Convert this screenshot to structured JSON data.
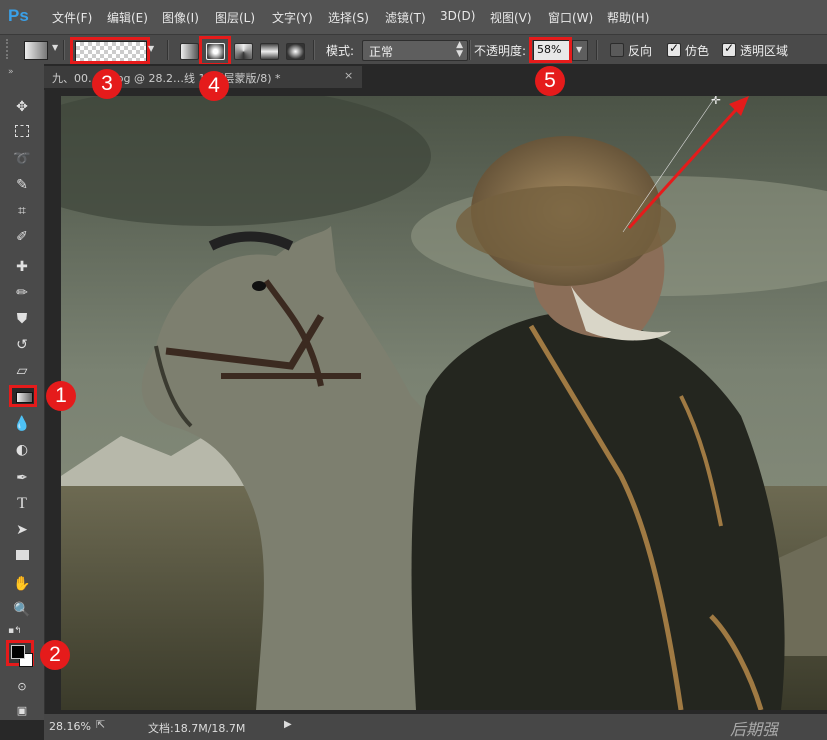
{
  "app": {
    "logo": "Ps"
  },
  "menu": [
    "文件(F)",
    "编辑(E)",
    "图像(I)",
    "图层(L)",
    "文字(Y)",
    "选择(S)",
    "滤镜(T)",
    "3D(D)",
    "视图(V)",
    "窗口(W)",
    "帮助(H)"
  ],
  "options": {
    "mode_label": "模式:",
    "mode_value": "正常",
    "opacity_label": "不透明度:",
    "opacity_value": "58%",
    "reverse_label": "反向",
    "dither_label": "仿色",
    "transparency_label": "透明区域",
    "gradient_types": [
      "linear",
      "radial",
      "angle",
      "reflected",
      "diamond"
    ],
    "selected_gradient_type": "radial"
  },
  "document": {
    "tab_title": "九、00…图.jpg @ 28.2…线 1, 图层蒙版/8) *",
    "close_glyph": "×"
  },
  "tools": [
    "move",
    "marquee",
    "lasso",
    "quick-select",
    "crop",
    "eyedropper",
    "healing",
    "brush",
    "stamp",
    "history-brush",
    "eraser",
    "gradient",
    "blur",
    "dodge",
    "pen",
    "type",
    "path-select",
    "rectangle",
    "hand",
    "zoom"
  ],
  "annotations": [
    "1",
    "2",
    "3",
    "4",
    "5"
  ],
  "status": {
    "zoom": "28.16%",
    "doc_info": "文档:18.7M/18.7M"
  },
  "watermark": "后期强",
  "colors": {
    "menubar": "#535353",
    "options": "#4a4a4a",
    "highlight": "#e51b1b",
    "ps_blue": "#3aa0e8"
  }
}
